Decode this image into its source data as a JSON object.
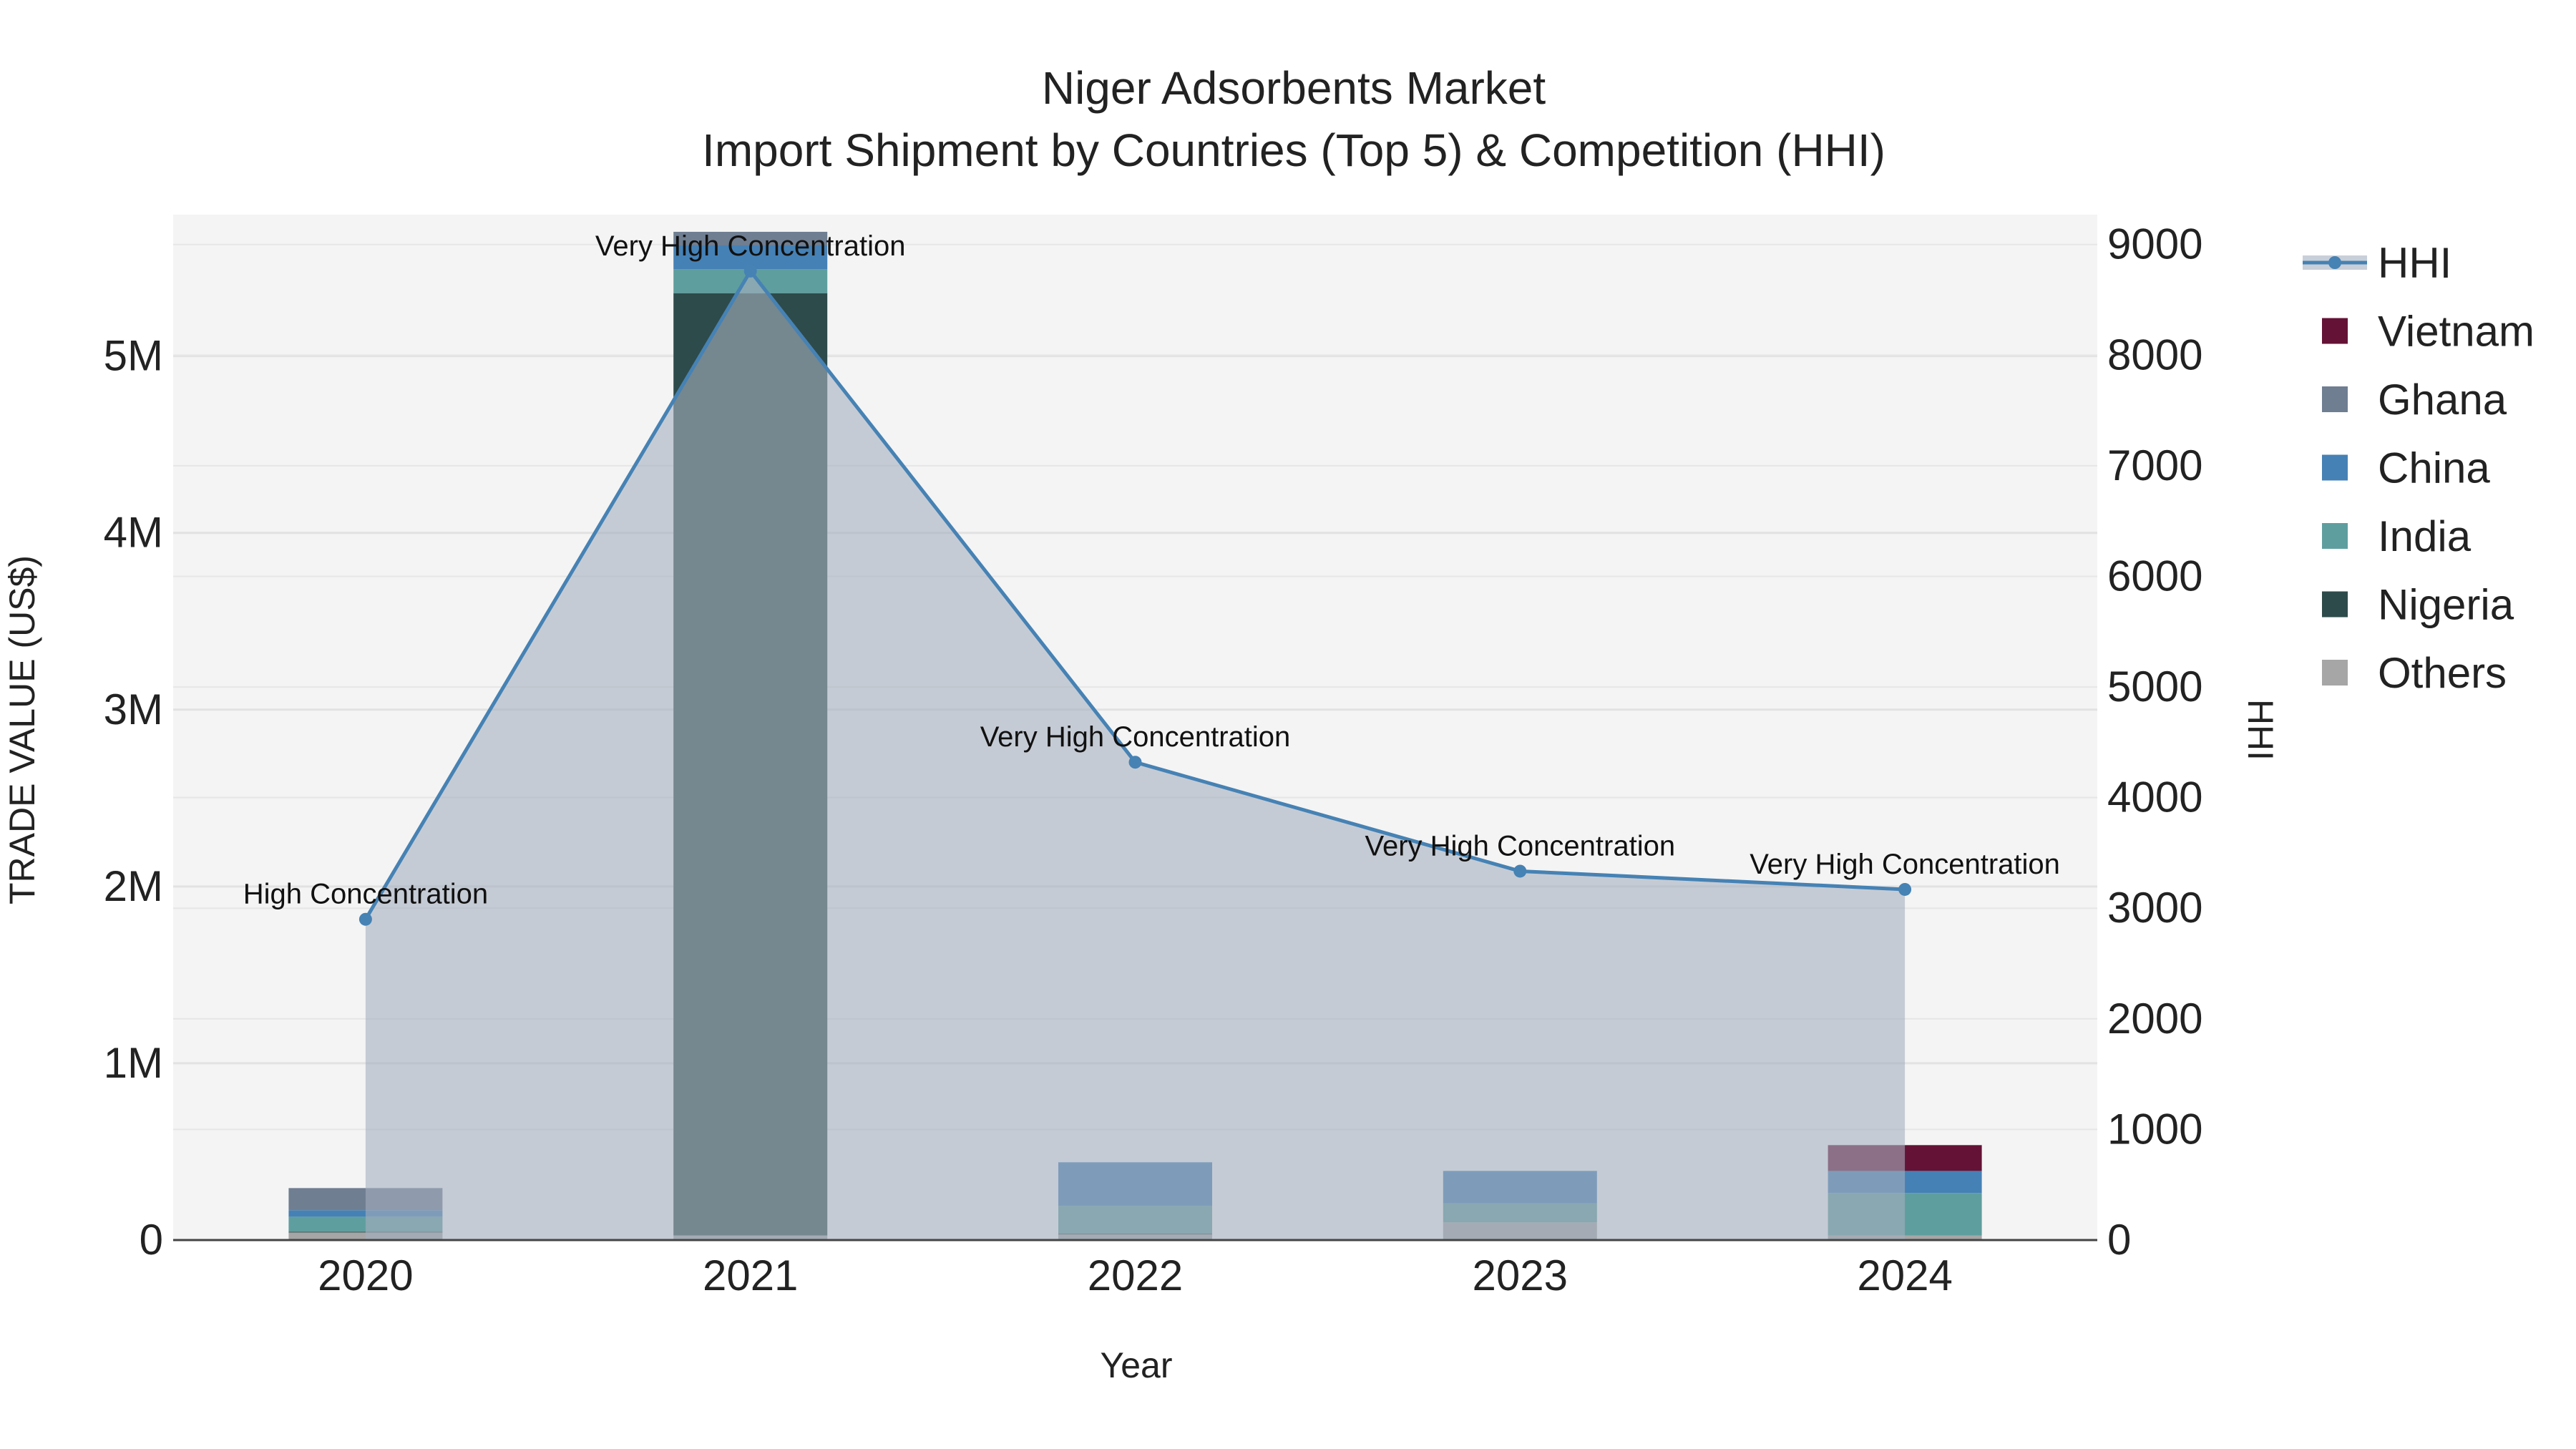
{
  "chart_data": {
    "type": "bar",
    "title": "Niger Adsorbents Market",
    "subtitle": "Import Shipment by Countries (Top 5) & Competition (HHI)",
    "xlabel": "Year",
    "ylabel": "TRADE VALUE (US$)",
    "y2label": "HHI",
    "categories": [
      "2020",
      "2021",
      "2022",
      "2023",
      "2024"
    ],
    "ylim": [
      0,
      5800000
    ],
    "y2lim": [
      0,
      9270
    ],
    "yticks": [
      {
        "v": 0,
        "label": "0"
      },
      {
        "v": 1000000,
        "label": "1M"
      },
      {
        "v": 2000000,
        "label": "2M"
      },
      {
        "v": 3000000,
        "label": "3M"
      },
      {
        "v": 4000000,
        "label": "4M"
      },
      {
        "v": 5000000,
        "label": "5M"
      }
    ],
    "y2ticks": [
      {
        "v": 0,
        "label": "0"
      },
      {
        "v": 1000,
        "label": "1000"
      },
      {
        "v": 2000,
        "label": "2000"
      },
      {
        "v": 3000,
        "label": "3000"
      },
      {
        "v": 4000,
        "label": "4000"
      },
      {
        "v": 5000,
        "label": "5000"
      },
      {
        "v": 6000,
        "label": "6000"
      },
      {
        "v": 7000,
        "label": "7000"
      },
      {
        "v": 8000,
        "label": "8000"
      },
      {
        "v": 9000,
        "label": "9000"
      }
    ],
    "series": [
      {
        "name": "Others",
        "color": "#a6a6a6",
        "values": [
          45000,
          26000,
          33000,
          100000,
          26000
        ]
      },
      {
        "name": "Nigeria",
        "color": "#2d4b4a",
        "values": [
          2000,
          5330000,
          3000,
          0,
          0
        ]
      },
      {
        "name": "India",
        "color": "#5f9e9f",
        "values": [
          85000,
          135000,
          158000,
          108000,
          240000
        ]
      },
      {
        "name": "China",
        "color": "#4581b5",
        "values": [
          37000,
          135000,
          246000,
          183000,
          125000
        ]
      },
      {
        "name": "Ghana",
        "color": "#6f7e91",
        "values": [
          125000,
          77000,
          0,
          0,
          0
        ]
      },
      {
        "name": "Vietnam",
        "color": "#641236",
        "values": [
          0,
          0,
          0,
          0,
          146000
        ]
      }
    ],
    "hhi": {
      "name": "HHI",
      "color": "#4682b4",
      "values": [
        2900,
        8760,
        4320,
        3335,
        3170
      ],
      "annotations": [
        "High Concentration",
        "Very High Concentration",
        "Very High Concentration",
        "Very High Concentration",
        "Very High Concentration"
      ]
    },
    "legend": {
      "placement": "right",
      "items": [
        "HHI",
        "Vietnam",
        "Ghana",
        "China",
        "India",
        "Nigeria",
        "Others"
      ]
    },
    "grid": true
  }
}
